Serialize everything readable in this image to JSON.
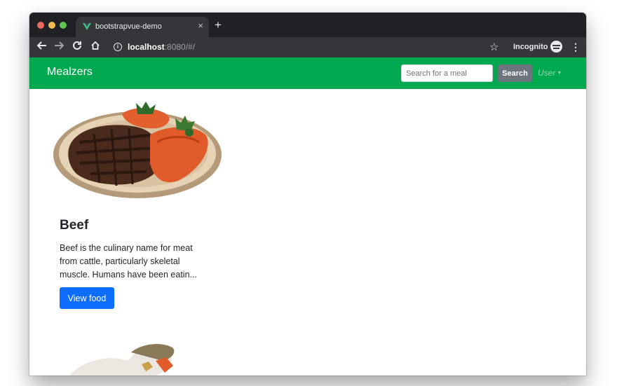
{
  "browser": {
    "tab_title": "bootstrapvue-demo",
    "tab_close": "×",
    "new_tab": "+",
    "url_host": "localhost",
    "url_rest": ":8080/#/",
    "incognito_label": "Incognito",
    "icons": [
      "back-icon",
      "forward-icon",
      "reload-icon",
      "home-icon",
      "info-icon",
      "star-icon",
      "incognito-icon",
      "menu-icon",
      "vue-logo-icon"
    ]
  },
  "navbar": {
    "brand": "Mealzers",
    "search_placeholder": "Search for a meal",
    "search_button": "Search",
    "user_menu": "User",
    "color": "#00a94f"
  },
  "cards": [
    {
      "title": "Beef",
      "text": "Beef is the culinary name for meat from cattle, particularly skeletal muscle. Humans have been eatin...",
      "button": "View food",
      "button_color": "#0d6efd"
    }
  ]
}
